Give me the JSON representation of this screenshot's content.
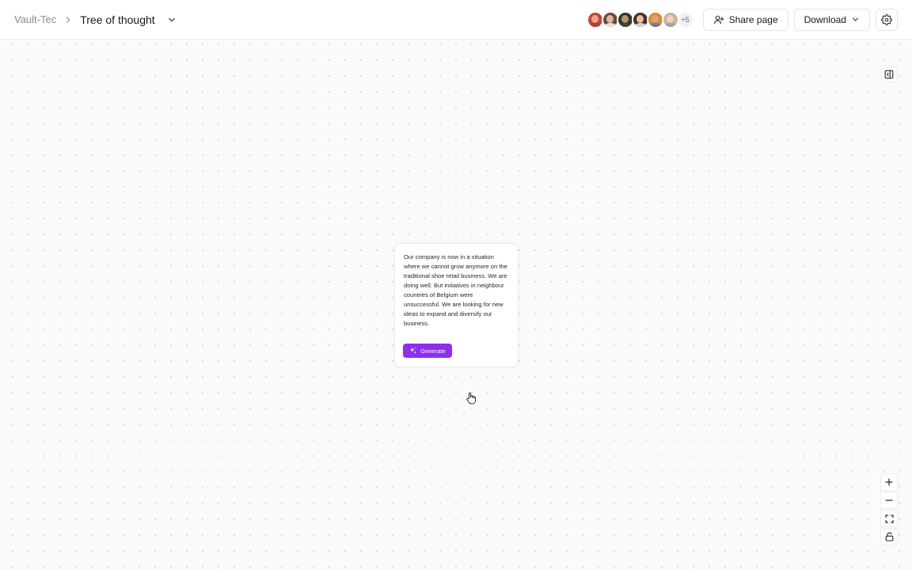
{
  "breadcrumb": {
    "root": "Vault-Tec",
    "current": "Tree of thought"
  },
  "collaborators": {
    "avatars": [
      {
        "name": "avatar-1",
        "skin": "#e8a48a",
        "hair": "#c2453a",
        "shirt": "#b53b30"
      },
      {
        "name": "avatar-2",
        "skin": "#d9b9a2",
        "hair": "#6b4a39",
        "shirt": "#e8e4df"
      },
      {
        "name": "avatar-3",
        "skin": "#bf9070",
        "hair": "#2b3a2d",
        "shirt": "#2f4a3a"
      },
      {
        "name": "avatar-4",
        "skin": "#e3c0a6",
        "hair": "#4a3026",
        "shirt": "#d9d2cc"
      },
      {
        "name": "avatar-5",
        "skin": "#d8a37c",
        "hair": "#d88a35",
        "shirt": "#6e7b8a"
      },
      {
        "name": "avatar-6",
        "skin": "#ead2bd",
        "hair": "#c8b59a",
        "shirt": "#a3a3a3"
      }
    ],
    "more_count": "+5"
  },
  "toolbar": {
    "share_label": "Share page",
    "download_label": "Download"
  },
  "node": {
    "text": "Our company is now in a situation where we cannot grow anymore on the traditional shoe retail business. We are doing well. But initiatives in neighbour countries of Belgium were unsuccessful. We are looking for new ideas to expand and diversify our business.",
    "generate_label": "Generate"
  },
  "colors": {
    "accent": "#8b2ff0",
    "canvas_bg": "#fafafa",
    "canvas_dot": "#d9d9dc"
  },
  "icons": {
    "breadcrumb_sep": "chevron-right-icon",
    "title_dropdown": "chevron-down-icon",
    "share": "user-plus-icon",
    "download_dropdown": "chevron-down-icon",
    "settings": "gear-icon",
    "panel": "sidebar-panel-icon",
    "generate": "sparkles-icon",
    "cursor": "hand-pointer-icon",
    "zoom_in": "plus-icon",
    "zoom_out": "minus-icon",
    "fit": "fullscreen-icon",
    "lock": "lock-open-icon"
  }
}
